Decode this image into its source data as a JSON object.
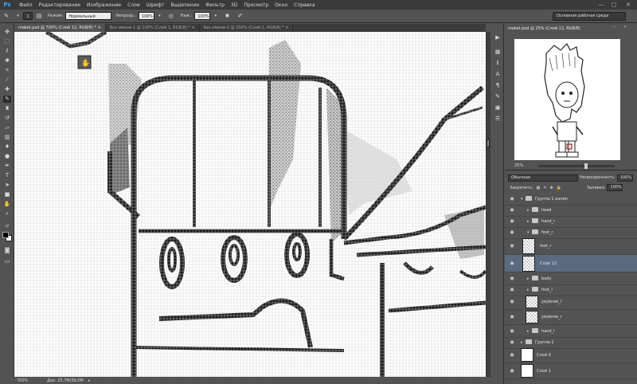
{
  "app": {
    "logo": "Ps"
  },
  "menu": [
    "Файл",
    "Редактирование",
    "Изображение",
    "Слои",
    "Шрифт",
    "Выделение",
    "Фильтр",
    "3D",
    "Просмотр",
    "Окно",
    "Справка"
  ],
  "window_controls": {
    "minimize": "—",
    "maximize": "▢",
    "close": "✕"
  },
  "options": {
    "brush_size": "1",
    "mode_label": "Режим:",
    "mode_value": "Нормальный",
    "opacity_label": "Непрозр.:",
    "opacity_value": "100%",
    "flow_label": "Наж.:",
    "flow_value": "100%",
    "workspace": "Основная рабочая среда"
  },
  "tabs": [
    {
      "label": "maket.psd @ 700% (Слой 12, RGB/8) *",
      "active": true
    },
    {
      "label": "Без имени-1 @ 100% (Слой 1, RGB/8) *",
      "active": false
    },
    {
      "label": "Без имени-2 @ 100% (Слой 1, RGB/8) *",
      "active": false
    }
  ],
  "tab_close": "×",
  "status": {
    "zoom": "700%",
    "doc": "Док: 25,7M/36,0M"
  },
  "navigator": {
    "title": "maket.psd @ 25% (Слой 12, RGB/8)",
    "zoom": "25%",
    "zoom_level": 0.25
  },
  "layers_panel": {
    "blend_mode": "Обычные",
    "opacity_label": "Непрозрачность:",
    "opacity_value": "100%",
    "lock_label": "Закрепить:",
    "fill_label": "Заливка:",
    "fill_value": "100%",
    "layers": [
      {
        "name": "Группа 1 копия",
        "kind": "group",
        "expanded": true,
        "indent": 0
      },
      {
        "name": "head",
        "kind": "group",
        "expanded": false,
        "indent": 1
      },
      {
        "name": "hand_r",
        "kind": "group",
        "expanded": false,
        "indent": 1
      },
      {
        "name": "foot_r",
        "kind": "group",
        "expanded": true,
        "indent": 1
      },
      {
        "name": "foot_r",
        "kind": "layer",
        "indent": 2,
        "tall": true
      },
      {
        "name": "Слой 12",
        "kind": "layer",
        "indent": 2,
        "tall": true,
        "selected": true
      },
      {
        "name": "body",
        "kind": "group",
        "expanded": false,
        "indent": 1
      },
      {
        "name": "foot_l",
        "kind": "group",
        "expanded": false,
        "indent": 1
      },
      {
        "name": "yeybrow_l",
        "kind": "layer",
        "indent": 1
      },
      {
        "name": "yeybrow_r",
        "kind": "layer",
        "indent": 1
      },
      {
        "name": "hand_l",
        "kind": "group",
        "expanded": false,
        "indent": 1
      },
      {
        "name": "Группа 1",
        "kind": "group",
        "expanded": false,
        "indent": 0
      },
      {
        "name": "Слой 0",
        "kind": "layer",
        "indent": 0,
        "plain": true
      },
      {
        "name": "Слой 1",
        "kind": "layer",
        "indent": 0,
        "plain": true
      }
    ]
  },
  "icons": {
    "tools": [
      "move-icon",
      "marquee-icon",
      "lasso-icon",
      "quick-select-icon",
      "crop-icon",
      "eyedropper-icon",
      "healing-icon",
      "brush-icon",
      "stamp-icon",
      "history-brush-icon",
      "eraser-icon",
      "gradient-icon",
      "blur-icon",
      "dodge-icon",
      "pen-icon",
      "type-icon",
      "path-select-icon",
      "shape-icon",
      "hand-icon",
      "zoom-icon"
    ],
    "colors": {
      "foreground": "#000000",
      "background": "#ffffff"
    }
  },
  "colors": {
    "accent": "#3ea8ff",
    "selected_layer": "#5a6a80",
    "navigator_box": "#b41a1a"
  }
}
